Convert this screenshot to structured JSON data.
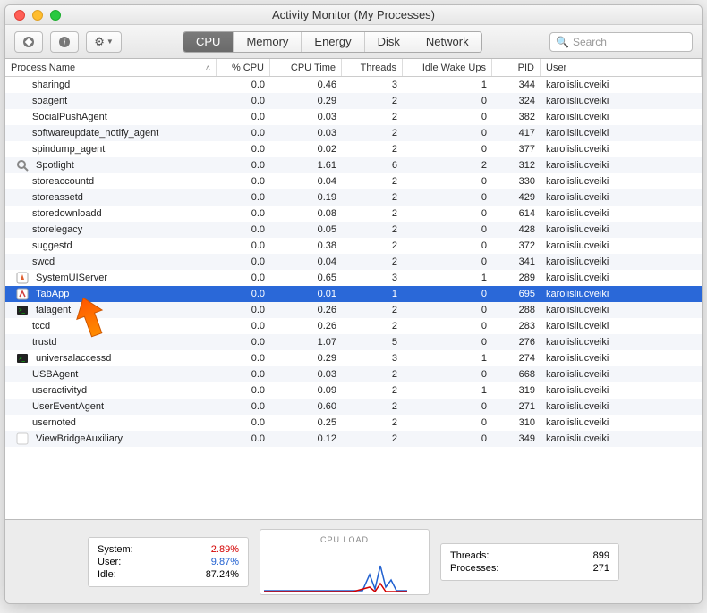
{
  "window": {
    "title": "Activity Monitor (My Processes)"
  },
  "toolbar": {
    "tabs": [
      "CPU",
      "Memory",
      "Energy",
      "Disk",
      "Network"
    ],
    "active_tab": "CPU",
    "search_placeholder": "Search"
  },
  "columns": {
    "name": "Process Name",
    "cpu": "% CPU",
    "time": "CPU Time",
    "threads": "Threads",
    "idle": "Idle Wake Ups",
    "pid": "PID",
    "user": "User"
  },
  "processes": [
    {
      "name": "sharingd",
      "cpu": "0.0",
      "time": "0.46",
      "threads": "3",
      "idle": "1",
      "pid": "344",
      "user": "karolisliucveiki"
    },
    {
      "name": "soagent",
      "cpu": "0.0",
      "time": "0.29",
      "threads": "2",
      "idle": "0",
      "pid": "324",
      "user": "karolisliucveiki"
    },
    {
      "name": "SocialPushAgent",
      "cpu": "0.0",
      "time": "0.03",
      "threads": "2",
      "idle": "0",
      "pid": "382",
      "user": "karolisliucveiki"
    },
    {
      "name": "softwareupdate_notify_agent",
      "cpu": "0.0",
      "time": "0.03",
      "threads": "2",
      "idle": "0",
      "pid": "417",
      "user": "karolisliucveiki"
    },
    {
      "name": "spindump_agent",
      "cpu": "0.0",
      "time": "0.02",
      "threads": "2",
      "idle": "0",
      "pid": "377",
      "user": "karolisliucveiki"
    },
    {
      "name": "Spotlight",
      "icon": "spotlight-icon",
      "cpu": "0.0",
      "time": "1.61",
      "threads": "6",
      "idle": "2",
      "pid": "312",
      "user": "karolisliucveiki"
    },
    {
      "name": "storeaccountd",
      "cpu": "0.0",
      "time": "0.04",
      "threads": "2",
      "idle": "0",
      "pid": "330",
      "user": "karolisliucveiki"
    },
    {
      "name": "storeassetd",
      "cpu": "0.0",
      "time": "0.19",
      "threads": "2",
      "idle": "0",
      "pid": "429",
      "user": "karolisliucveiki"
    },
    {
      "name": "storedownloadd",
      "cpu": "0.0",
      "time": "0.08",
      "threads": "2",
      "idle": "0",
      "pid": "614",
      "user": "karolisliucveiki"
    },
    {
      "name": "storelegacy",
      "cpu": "0.0",
      "time": "0.05",
      "threads": "2",
      "idle": "0",
      "pid": "428",
      "user": "karolisliucveiki"
    },
    {
      "name": "suggestd",
      "cpu": "0.0",
      "time": "0.38",
      "threads": "2",
      "idle": "0",
      "pid": "372",
      "user": "karolisliucveiki"
    },
    {
      "name": "swcd",
      "cpu": "0.0",
      "time": "0.04",
      "threads": "2",
      "idle": "0",
      "pid": "341",
      "user": "karolisliucveiki"
    },
    {
      "name": "SystemUIServer",
      "icon": "systemui-icon",
      "cpu": "0.0",
      "time": "0.65",
      "threads": "3",
      "idle": "1",
      "pid": "289",
      "user": "karolisliucveiki"
    },
    {
      "name": "TabApp",
      "icon": "tabapp-icon",
      "cpu": "0.0",
      "time": "0.01",
      "threads": "1",
      "idle": "0",
      "pid": "695",
      "user": "karolisliucveiki",
      "selected": true,
      "pointed": true
    },
    {
      "name": "talagent",
      "icon": "terminal-icon",
      "cpu": "0.0",
      "time": "0.26",
      "threads": "2",
      "idle": "0",
      "pid": "288",
      "user": "karolisliucveiki"
    },
    {
      "name": "tccd",
      "cpu": "0.0",
      "time": "0.26",
      "threads": "2",
      "idle": "0",
      "pid": "283",
      "user": "karolisliucveiki"
    },
    {
      "name": "trustd",
      "cpu": "0.0",
      "time": "1.07",
      "threads": "5",
      "idle": "0",
      "pid": "276",
      "user": "karolisliucveiki"
    },
    {
      "name": "universalaccessd",
      "icon": "terminal-icon",
      "cpu": "0.0",
      "time": "0.29",
      "threads": "3",
      "idle": "1",
      "pid": "274",
      "user": "karolisliucveiki"
    },
    {
      "name": "USBAgent",
      "cpu": "0.0",
      "time": "0.03",
      "threads": "2",
      "idle": "0",
      "pid": "668",
      "user": "karolisliucveiki"
    },
    {
      "name": "useractivityd",
      "cpu": "0.0",
      "time": "0.09",
      "threads": "2",
      "idle": "1",
      "pid": "319",
      "user": "karolisliucveiki"
    },
    {
      "name": "UserEventAgent",
      "cpu": "0.0",
      "time": "0.60",
      "threads": "2",
      "idle": "0",
      "pid": "271",
      "user": "karolisliucveiki"
    },
    {
      "name": "usernoted",
      "cpu": "0.0",
      "time": "0.25",
      "threads": "2",
      "idle": "0",
      "pid": "310",
      "user": "karolisliucveiki"
    },
    {
      "name": "ViewBridgeAuxiliary",
      "icon": "viewbridge-icon",
      "cpu": "0.0",
      "time": "0.12",
      "threads": "2",
      "idle": "0",
      "pid": "349",
      "user": "karolisliucveiki"
    }
  ],
  "cpu_stats": {
    "system_label": "System:",
    "system": "2.89%",
    "user_label": "User:",
    "user": "9.87%",
    "idle_label": "Idle:",
    "idle": "87.24%",
    "load_label": "CPU LOAD",
    "threads_label": "Threads:",
    "threads": "899",
    "processes_label": "Processes:",
    "processes": "271"
  }
}
